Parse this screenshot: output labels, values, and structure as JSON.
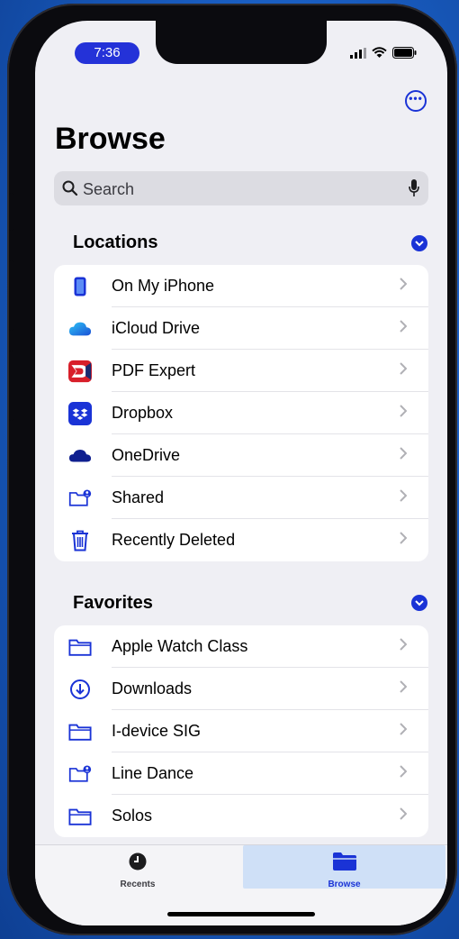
{
  "status": {
    "time": "7:36"
  },
  "header": {
    "title": "Browse"
  },
  "search": {
    "placeholder": "Search"
  },
  "locations": {
    "heading": "Locations",
    "items": [
      {
        "label": "On My iPhone",
        "icon": "phone-icon"
      },
      {
        "label": "iCloud Drive",
        "icon": "icloud-icon"
      },
      {
        "label": "PDF Expert",
        "icon": "pdf-expert-icon"
      },
      {
        "label": "Dropbox",
        "icon": "dropbox-icon"
      },
      {
        "label": "OneDrive",
        "icon": "onedrive-icon"
      },
      {
        "label": "Shared",
        "icon": "shared-folder-icon"
      },
      {
        "label": "Recently Deleted",
        "icon": "trash-icon"
      }
    ]
  },
  "favorites": {
    "heading": "Favorites",
    "items": [
      {
        "label": "Apple Watch Class",
        "icon": "folder-icon"
      },
      {
        "label": "Downloads",
        "icon": "download-icon"
      },
      {
        "label": "I-device SIG",
        "icon": "folder-icon"
      },
      {
        "label": "Line Dance",
        "icon": "shared-folder-icon"
      },
      {
        "label": "Solos",
        "icon": "folder-icon"
      }
    ]
  },
  "tabbar": {
    "recents": "Recents",
    "browse": "Browse"
  },
  "colors": {
    "accent": "#1a33d6",
    "selected_tab_bg": "#cfe0f7"
  }
}
